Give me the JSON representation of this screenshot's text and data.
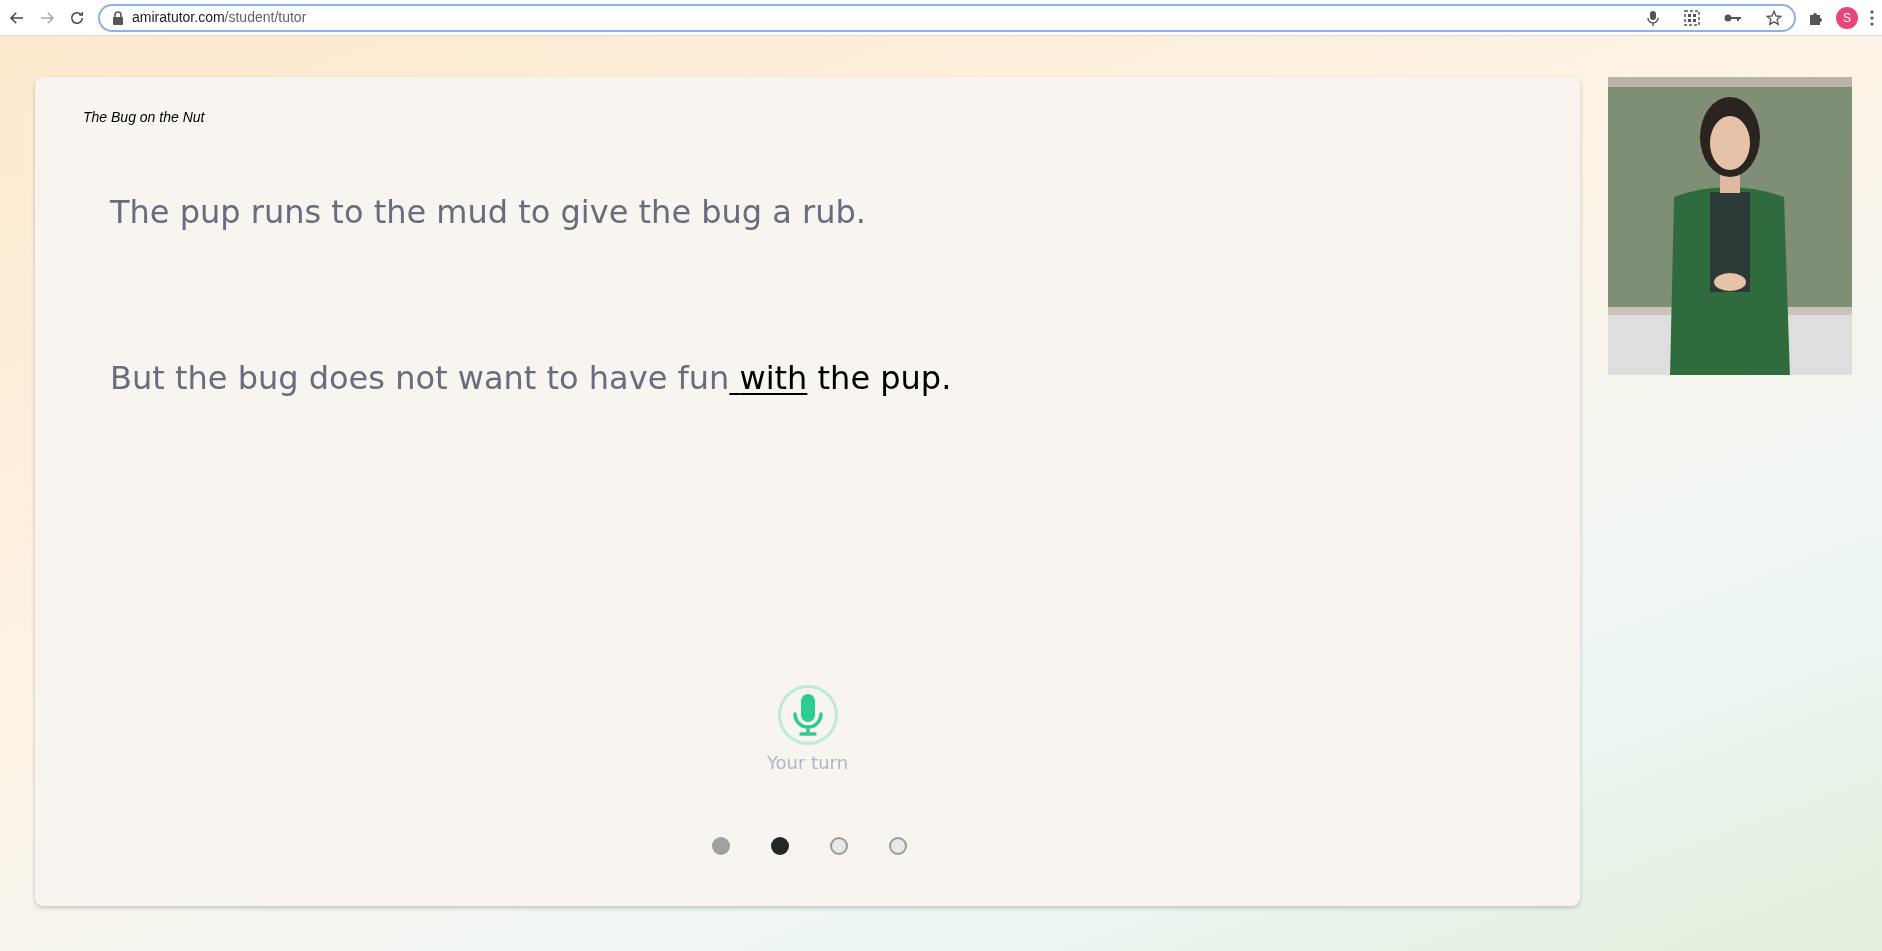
{
  "browser": {
    "url_host": "amiratutor.com",
    "url_path": "/student/tutor",
    "profile_initial": "S"
  },
  "story": {
    "title": "The Bug on the Nut",
    "sentences": [
      {
        "segments": [
          {
            "text": "The pup runs to the mud to give the bug a rub.",
            "kind": "read"
          }
        ]
      },
      {
        "segments": [
          {
            "text": "But the bug does not want to have fun",
            "kind": "read"
          },
          {
            "text": "with",
            "kind": "current"
          },
          {
            "text": "the pup.",
            "kind": "unread"
          }
        ]
      }
    ]
  },
  "mic": {
    "label": "Your turn",
    "on": true
  },
  "pages": [
    {
      "kind": "done"
    },
    {
      "kind": "current"
    },
    {
      "kind": "upcoming"
    },
    {
      "kind": "upcoming"
    }
  ]
}
